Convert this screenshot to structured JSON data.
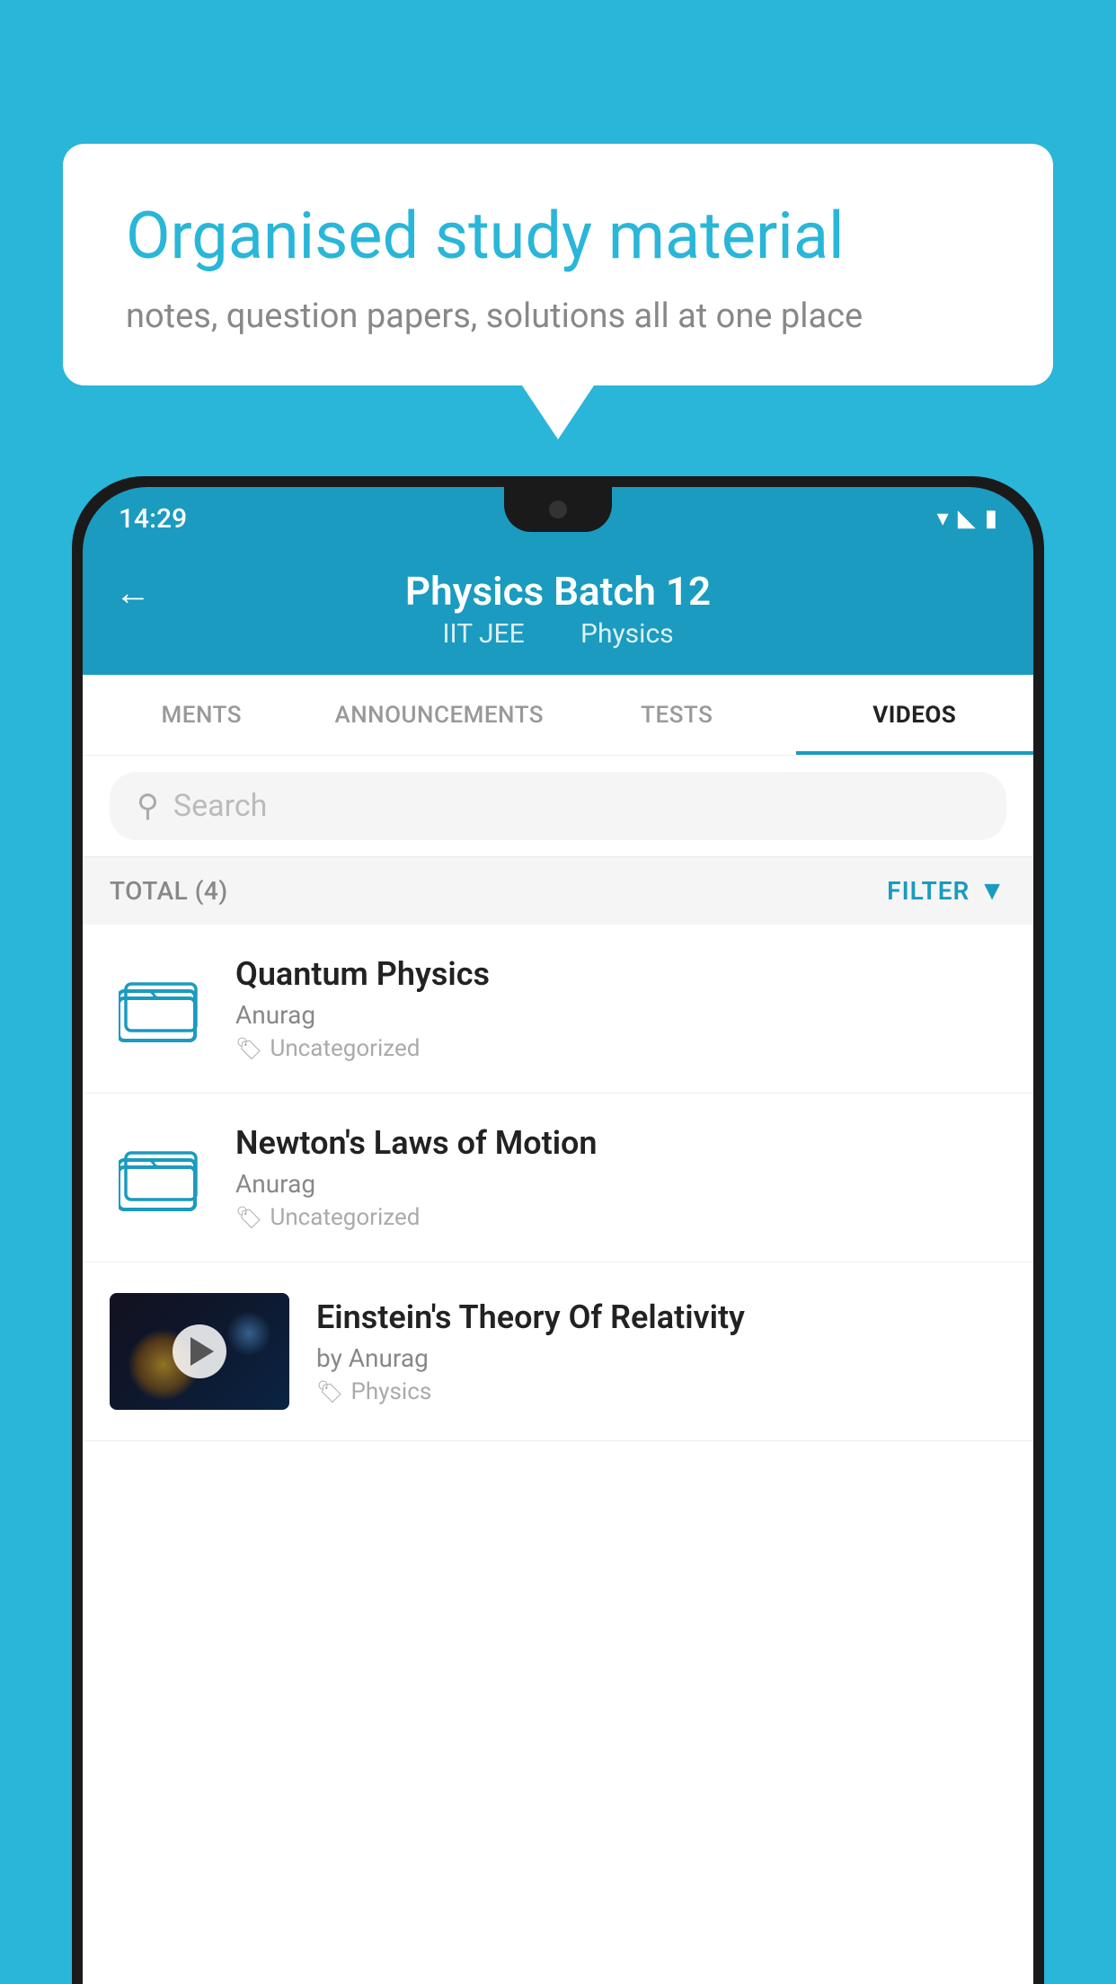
{
  "background": {
    "color": "#29b6d8"
  },
  "speech_bubble": {
    "title": "Organised study material",
    "subtitle": "notes, question papers, solutions all at one place"
  },
  "status_bar": {
    "time": "14:29",
    "icons": [
      "wifi",
      "signal",
      "battery"
    ]
  },
  "app_header": {
    "back_label": "←",
    "title": "Physics Batch 12",
    "subtitle_part1": "IIT JEE",
    "subtitle_part2": "Physics"
  },
  "tabs": [
    {
      "label": "MENTS",
      "active": false
    },
    {
      "label": "ANNOUNCEMENTS",
      "active": false
    },
    {
      "label": "TESTS",
      "active": false
    },
    {
      "label": "VIDEOS",
      "active": true
    }
  ],
  "search": {
    "placeholder": "Search"
  },
  "total_bar": {
    "total_label": "TOTAL (4)",
    "filter_label": "FILTER"
  },
  "video_items": [
    {
      "title": "Quantum Physics",
      "author": "Anurag",
      "tag": "Uncategorized",
      "type": "folder"
    },
    {
      "title": "Newton's Laws of Motion",
      "author": "Anurag",
      "tag": "Uncategorized",
      "type": "folder"
    },
    {
      "title": "Einstein's Theory Of Relativity",
      "author": "by Anurag",
      "tag": "Physics",
      "type": "video"
    }
  ]
}
